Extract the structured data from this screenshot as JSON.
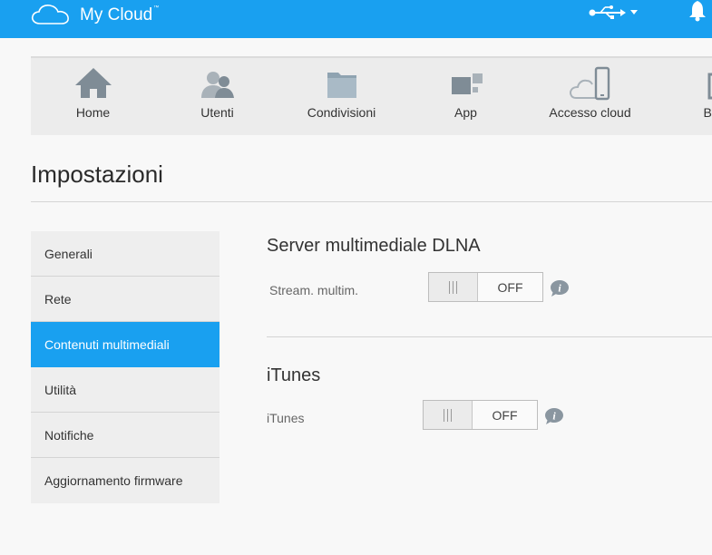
{
  "header": {
    "brand": "My Cloud",
    "brand_tm": "™",
    "brand_color": "#19a0f0",
    "icons": [
      "cloud-logo-icon",
      "usb-icon",
      "bell-icon"
    ]
  },
  "nav": {
    "items": [
      {
        "label": "Home",
        "icon": "home-icon"
      },
      {
        "label": "Utenti",
        "icon": "users-icon"
      },
      {
        "label": "Condivisioni",
        "icon": "folder-icon"
      },
      {
        "label": "App",
        "icon": "apps-icon"
      },
      {
        "label": "Accesso cloud",
        "icon": "cloud-device-icon"
      },
      {
        "label": "Bac",
        "icon": "backup-icon"
      }
    ]
  },
  "page": {
    "title": "Impostazioni"
  },
  "sidebar": {
    "items": [
      {
        "label": "Generali",
        "active": false
      },
      {
        "label": "Rete",
        "active": false
      },
      {
        "label": "Contenuti multimediali",
        "active": true
      },
      {
        "label": "Utilità",
        "active": false
      },
      {
        "label": "Notifiche",
        "active": false
      },
      {
        "label": "Aggiornamento firmware",
        "active": false
      }
    ]
  },
  "main": {
    "dlna": {
      "title": "Server multimediale DLNA",
      "setting_label": "Stream. multim.",
      "toggle_state": "OFF"
    },
    "itunes": {
      "title": "iTunes",
      "setting_label": "iTunes",
      "toggle_state": "OFF"
    }
  }
}
